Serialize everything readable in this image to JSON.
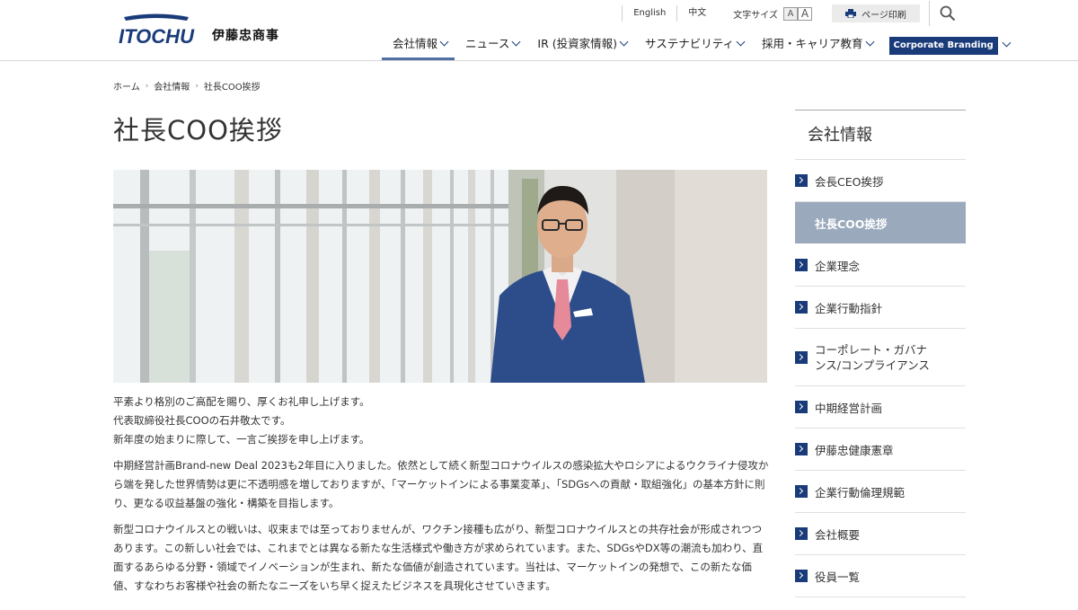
{
  "brand": {
    "logo_text": "ITOCHU",
    "name_jp": "伊藤忠商事"
  },
  "utility": {
    "english": "English",
    "chinese": "中文",
    "font_size_label": "文字サイズ",
    "font_small": "A",
    "font_large": "A",
    "print_label": "ページ印刷"
  },
  "gnav": {
    "items": [
      {
        "label": "会社情報"
      },
      {
        "label": "ニュース"
      },
      {
        "label": "IR (投資家情報)"
      },
      {
        "label": "サステナビリティ"
      },
      {
        "label": "採用・キャリア教育"
      }
    ],
    "corporate_branding": "Corporate Branding"
  },
  "breadcrumb": {
    "home": "ホーム",
    "parent": "会社情報",
    "current": "社長COO挨拶"
  },
  "page": {
    "title": "社長COO挨拶"
  },
  "content": {
    "p1_l1": "平素より格別のご高配を賜り、厚くお礼申し上げます。",
    "p1_l2": "代表取締役社長COOの石井敬太です。",
    "p1_l3": "新年度の始まりに際して、一言ご挨拶を申し上げます。",
    "p2": "中期経営計画Brand-new Deal 2023も2年目に入りました。依然として続く新型コロナウイルスの感染拡大やロシアによるウクライナ侵攻から端を発した世界情勢は更に不透明感を増しておりますが、「マーケットインによる事業変革」、「SDGsへの貢献・取組強化」の基本方針に則り、更なる収益基盤の強化・構築を目指します。",
    "p3": "新型コロナウイルスとの戦いは、収束までは至っておりませんが、ワクチン接種も広がり、新型コロナウイルスとの共存社会が形成されつつあります。この新しい社会では、これまでとは異なる新たな生活様式や働き方が求められています。また、SDGsやDX等の潮流も加わり、直面するあらゆる分野・領域でイノベーションが生まれ、新たな価値が創造されています。当社は、マーケットインの発想で、この新たな価値、すなわちお客様や社会の新たなニーズをいち早く捉えたビジネスを具現化させていきます。"
  },
  "sidebar": {
    "title": "会社情報",
    "items": [
      {
        "label": "会長CEO挨拶"
      },
      {
        "label": "社長COO挨拶"
      },
      {
        "label": "企業理念"
      },
      {
        "label": "企業行動指針"
      },
      {
        "label": "コーポレート・ガバナンス/コンプライアンス"
      },
      {
        "label": "中期経営計画"
      },
      {
        "label": "伊藤忠健康憲章"
      },
      {
        "label": "企業行動倫理規範"
      },
      {
        "label": "会社概要"
      },
      {
        "label": "役員一覧"
      }
    ]
  },
  "colors": {
    "brand_navy": "#1a3b7a",
    "active_sidebar": "#9aa9bc"
  },
  "icons": [
    "print-icon",
    "search-icon",
    "chevron-down-icon",
    "arrow-right-icon"
  ]
}
